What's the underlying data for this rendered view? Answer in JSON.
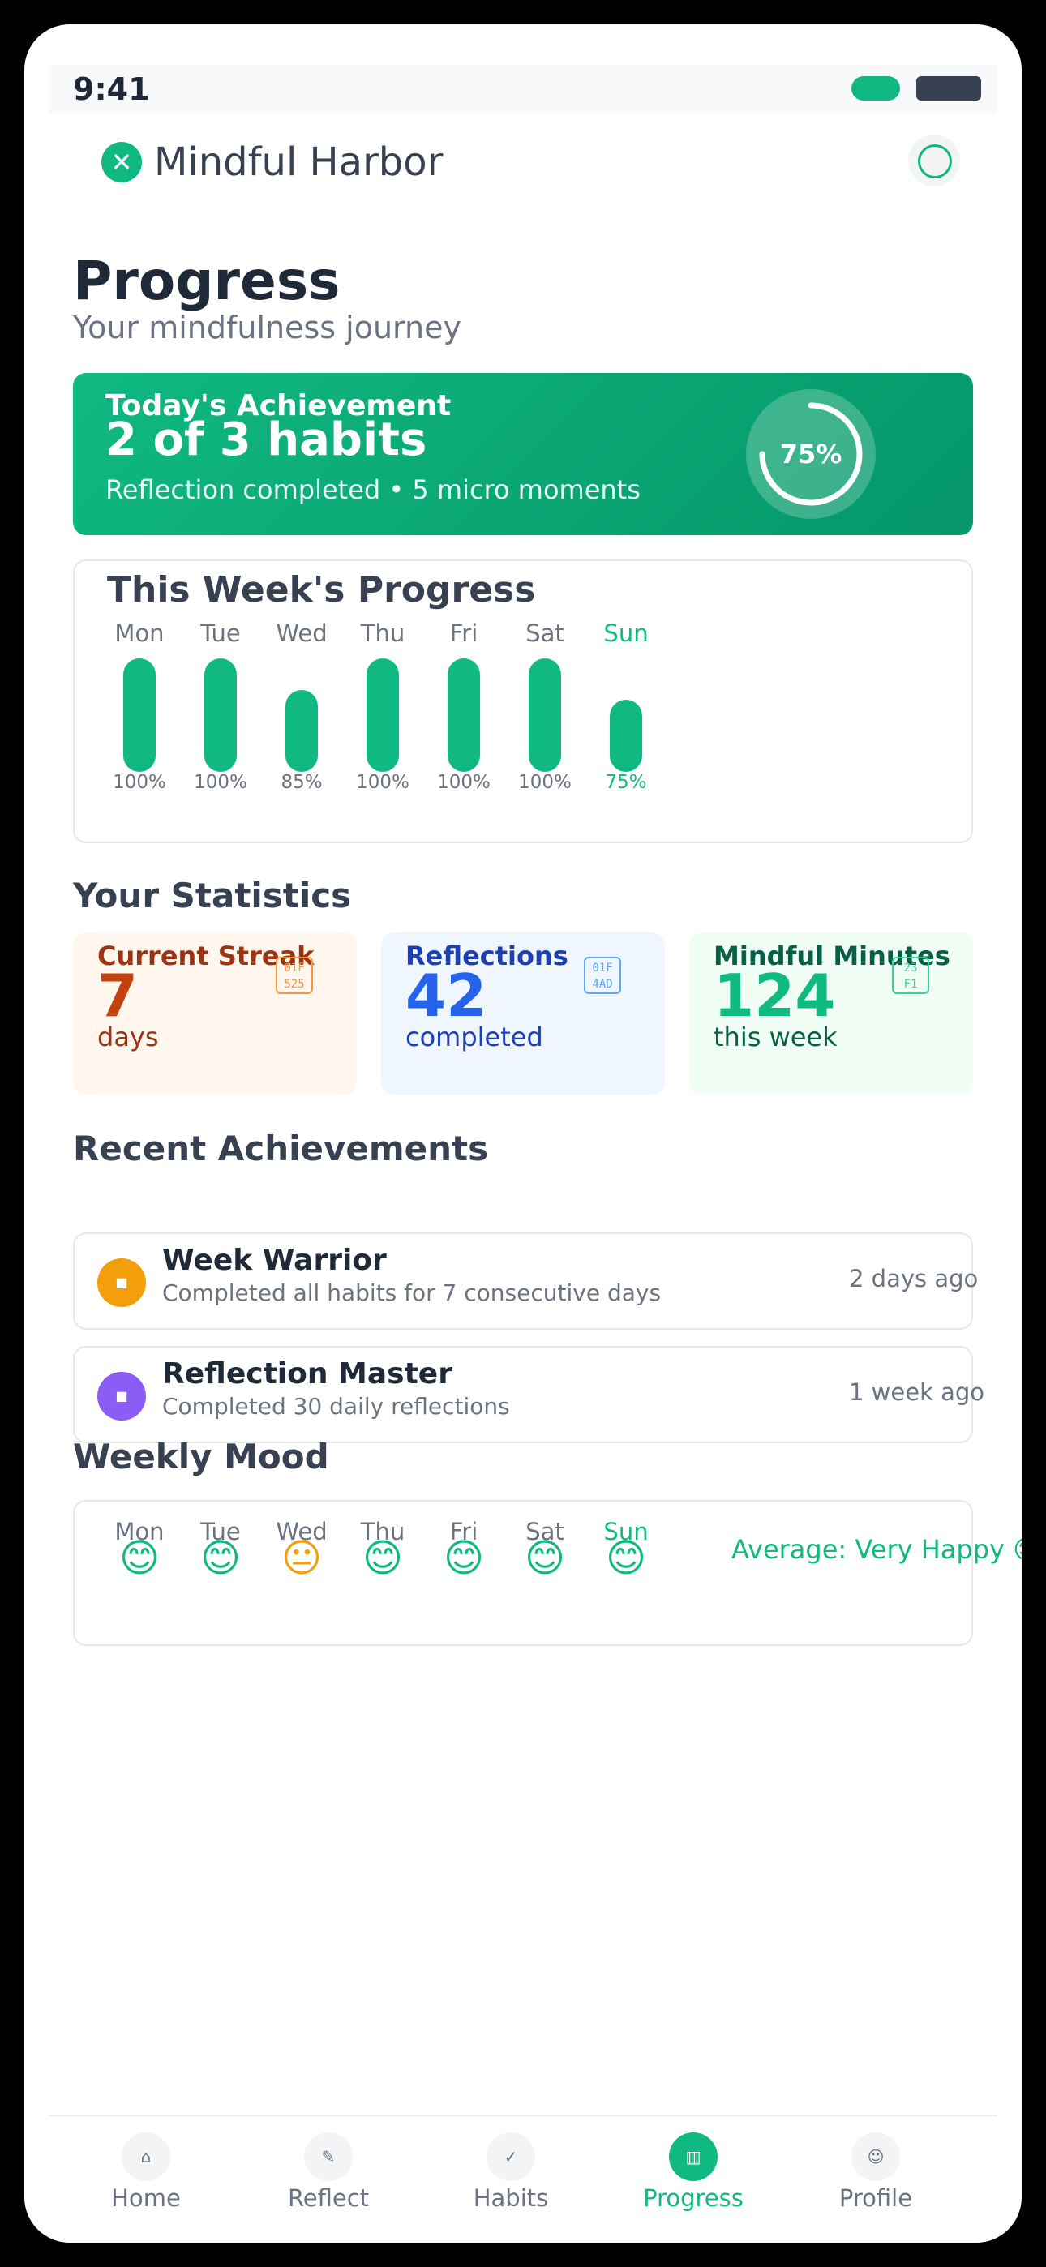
{
  "status": {
    "time": "9:41"
  },
  "header": {
    "logo_glyph": "✕",
    "app_name": "Mindful Harbor"
  },
  "page": {
    "title": "Progress",
    "subtitle": "Your mindfulness journey"
  },
  "achievement": {
    "label": "Today's Achievement",
    "value": "2 of 3 habits",
    "detail": "Reflection completed • 5 micro moments",
    "percent": 75,
    "percent_label": "75%"
  },
  "week": {
    "title": "This Week's Progress",
    "days": [
      {
        "day": "Mon",
        "value": 100,
        "label": "100%",
        "today": false
      },
      {
        "day": "Tue",
        "value": 100,
        "label": "100%",
        "today": false
      },
      {
        "day": "Wed",
        "value": 85,
        "label": "85%",
        "today": false
      },
      {
        "day": "Thu",
        "value": 100,
        "label": "100%",
        "today": false
      },
      {
        "day": "Fri",
        "value": 100,
        "label": "100%",
        "today": false
      },
      {
        "day": "Sat",
        "value": 100,
        "label": "100%",
        "today": false
      },
      {
        "day": "Sun",
        "value": 75,
        "label": "75%",
        "today": true
      }
    ]
  },
  "stats": {
    "title": "Your Statistics",
    "items": [
      {
        "label": "Current Streak",
        "value": "7",
        "unit": "days",
        "icon": "fire-icon",
        "icon_glyph": "01F\n525",
        "bg": "#fff7ed",
        "label_color": "#9a3412",
        "value_color": "#c2410c",
        "icon_color": "#fb923c"
      },
      {
        "label": "Reflections",
        "value": "42",
        "unit": "completed",
        "icon": "notebook-icon",
        "icon_glyph": "01F\n4AD",
        "bg": "#eff6ff",
        "label_color": "#1e40af",
        "value_color": "#2563eb",
        "icon_color": "#60a5fa"
      },
      {
        "label": "Mindful Minutes",
        "value": "124",
        "unit": "this week",
        "icon": "hourglass-icon",
        "icon_glyph": "23\nF1",
        "bg": "#f0fdf4",
        "label_color": "#065f46",
        "value_color": "#10b981",
        "icon_color": "#34d399"
      }
    ]
  },
  "recent": {
    "title": "Recent Achievements",
    "items": [
      {
        "name": "Week Warrior",
        "desc": "Completed all habits for 7 consecutive days",
        "time": "2 days ago",
        "icon": "trophy-icon",
        "color": "#f59e0b"
      },
      {
        "name": "Reflection Master",
        "desc": "Completed 30 daily reflections",
        "time": "1 week ago",
        "icon": "star-icon",
        "color": "#8b5cf6"
      }
    ]
  },
  "mood": {
    "title": "Weekly Mood",
    "days": [
      {
        "day": "Mon",
        "face": "😊",
        "color": "#10b981",
        "today": false
      },
      {
        "day": "Tue",
        "face": "😊",
        "color": "#10b981",
        "today": false
      },
      {
        "day": "Wed",
        "face": "😐",
        "color": "#f59e0b",
        "today": false
      },
      {
        "day": "Thu",
        "face": "😊",
        "color": "#10b981",
        "today": false
      },
      {
        "day": "Fri",
        "face": "😊",
        "color": "#10b981",
        "today": false
      },
      {
        "day": "Sat",
        "face": "😊",
        "color": "#10b981",
        "today": false
      },
      {
        "day": "Sun",
        "face": "😊",
        "color": "#10b981",
        "today": true
      }
    ],
    "average": "Average: Very Happy 😊"
  },
  "nav": {
    "items": [
      {
        "label": "Home",
        "icon": "home-icon",
        "glyph": "⌂",
        "active": false
      },
      {
        "label": "Reflect",
        "icon": "reflect-icon",
        "glyph": "✎",
        "active": false
      },
      {
        "label": "Habits",
        "icon": "check-icon",
        "glyph": "✓",
        "active": false
      },
      {
        "label": "Progress",
        "icon": "chart-icon",
        "glyph": "▥",
        "active": true
      },
      {
        "label": "Profile",
        "icon": "profile-icon",
        "glyph": "☺",
        "active": false
      }
    ]
  },
  "colors": {
    "accent": "#10b981",
    "accent_dark": "#059669",
    "text": "#1f2937",
    "muted": "#6b7280"
  }
}
